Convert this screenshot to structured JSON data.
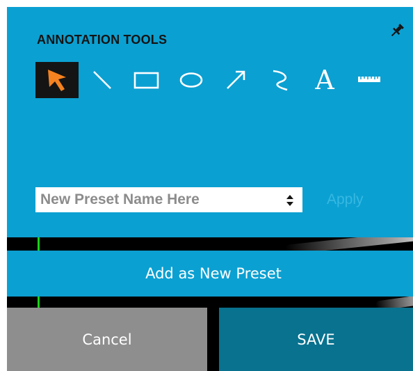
{
  "annotation_panel": {
    "title": "ANNOTATION TOOLS",
    "pin_icon": "pin-icon",
    "tools": [
      {
        "name": "select-tool",
        "icon": "cursor-arrow-icon",
        "selected": true
      },
      {
        "name": "line-tool",
        "icon": "line-icon",
        "selected": false
      },
      {
        "name": "rectangle-tool",
        "icon": "rectangle-icon",
        "selected": false
      },
      {
        "name": "ellipse-tool",
        "icon": "ellipse-icon",
        "selected": false
      },
      {
        "name": "arrow-tool",
        "icon": "arrow-icon",
        "selected": false
      },
      {
        "name": "freehand-tool",
        "icon": "freehand-icon",
        "selected": false
      },
      {
        "name": "text-tool",
        "icon": "text-icon",
        "glyph": "A",
        "selected": false
      },
      {
        "name": "ruler-tool",
        "icon": "ruler-icon",
        "selected": false
      }
    ],
    "preset": {
      "placeholder": "New Preset Name Here",
      "apply_label": "Apply"
    }
  },
  "add_preset_label": "Add as New Preset",
  "footer": {
    "cancel_label": "Cancel",
    "save_label": "SAVE"
  },
  "colors": {
    "panel_blue": "#0ba0d2",
    "save_blue": "#08728f",
    "cancel_gray": "#8e8e8e",
    "selected_tool_bg": "#141414",
    "cursor_orange": "#f58220",
    "apply_disabled": "#37b8e2",
    "guide_green": "#19d219"
  }
}
